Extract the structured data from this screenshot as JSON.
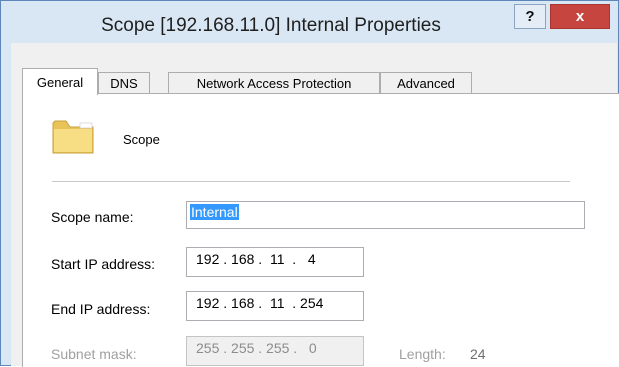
{
  "window": {
    "title": "Scope [192.168.11.0] Internal Properties",
    "help_label": "?",
    "close_label": "x"
  },
  "tabs": [
    {
      "label": "General",
      "active": true
    },
    {
      "label": "DNS",
      "active": false
    },
    {
      "label": "Network Access Protection",
      "active": false
    },
    {
      "label": "Advanced",
      "active": false
    }
  ],
  "general": {
    "header_label": "Scope",
    "header_icon": "folder-icon",
    "scope_name_label": "Scope name:",
    "scope_name_value": "Internal",
    "start_ip_label": "Start IP address:",
    "start_ip_value": "192 . 168 .  11  .   4",
    "end_ip_label": "End IP address:",
    "end_ip_value": "192 . 168 .  11  . 254",
    "subnet_label": "Subnet mask:",
    "subnet_value": "255 . 255 . 255 .   0",
    "length_label": "Length:",
    "length_value": "24"
  },
  "colors": {
    "title_bg": "#d9e6f3",
    "close_button": "#c6463f",
    "selection": "#3399ff"
  }
}
